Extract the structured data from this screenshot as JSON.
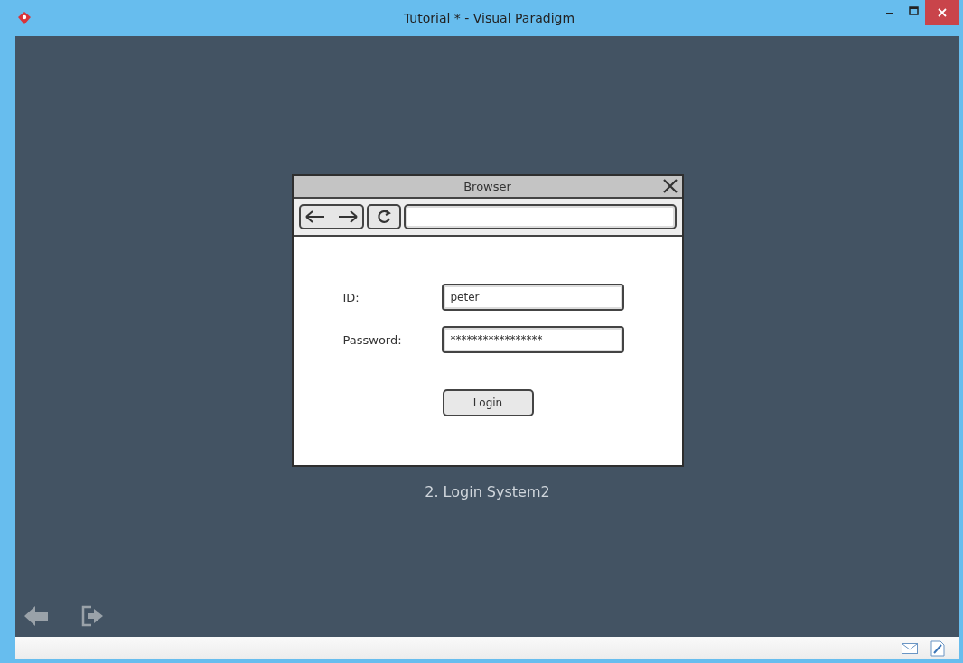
{
  "window": {
    "title": "Tutorial * - Visual Paradigm"
  },
  "mockup": {
    "title": "Browser",
    "fields": [
      {
        "label": "ID:",
        "value": "peter"
      },
      {
        "label": "Password:",
        "value": "*****************"
      }
    ],
    "button": "Login"
  },
  "caption": "2. Login System2"
}
